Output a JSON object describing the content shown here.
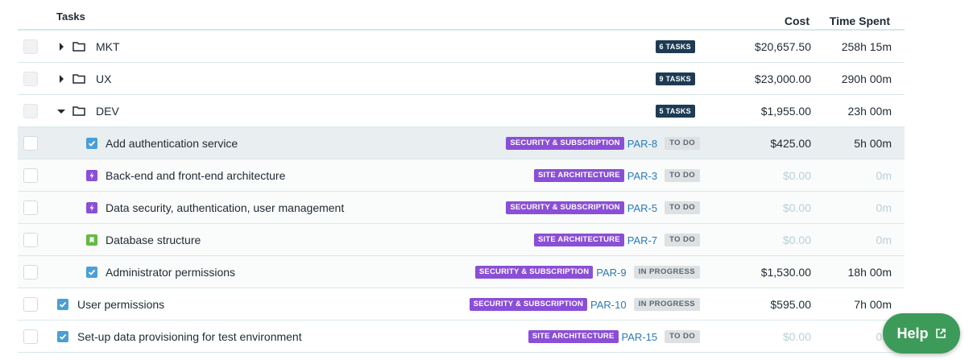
{
  "header": {
    "tasks": "Tasks",
    "cost": "Cost",
    "time": "Time Spent"
  },
  "groups": [
    {
      "name": "MKT",
      "count": "6 TASKS",
      "cost": "$20,657.50",
      "time": "258h 15m",
      "expanded": false
    },
    {
      "name": "UX",
      "count": "9 TASKS",
      "cost": "$23,000.00",
      "time": "290h 00m",
      "expanded": false
    },
    {
      "name": "DEV",
      "count": "5 TASKS",
      "cost": "$1,955.00",
      "time": "23h 00m",
      "expanded": true
    }
  ],
  "tasks": [
    {
      "name": "Add authentication service",
      "type": "task-icon",
      "epic": "SECURITY & SUBSCRIPTION",
      "key": "PAR-8",
      "status": "TO DO",
      "cost": "$425.00",
      "time": "5h 00m",
      "level": "child",
      "muted": false
    },
    {
      "name": "Back-end and front-end architecture",
      "type": "epic-icon",
      "epic": "SITE ARCHITECTURE",
      "key": "PAR-3",
      "status": "TO DO",
      "cost": "$0.00",
      "time": "0m",
      "level": "child",
      "muted": true
    },
    {
      "name": "Data security, authentication, user management",
      "type": "epic-icon",
      "epic": "SECURITY & SUBSCRIPTION",
      "key": "PAR-5",
      "status": "TO DO",
      "cost": "$0.00",
      "time": "0m",
      "level": "child",
      "muted": true
    },
    {
      "name": "Database structure",
      "type": "story-icon",
      "epic": "SITE ARCHITECTURE",
      "key": "PAR-7",
      "status": "TO DO",
      "cost": "$0.00",
      "time": "0m",
      "level": "child",
      "muted": true
    },
    {
      "name": "Administrator permissions",
      "type": "task-icon",
      "epic": "SECURITY & SUBSCRIPTION",
      "key": "PAR-9",
      "status": "IN PROGRESS",
      "cost": "$1,530.00",
      "time": "18h 00m",
      "level": "child",
      "muted": false
    },
    {
      "name": "User permissions",
      "type": "task-icon",
      "epic": "SECURITY & SUBSCRIPTION",
      "key": "PAR-10",
      "status": "IN PROGRESS",
      "cost": "$595.00",
      "time": "7h 00m",
      "level": "top",
      "muted": false
    },
    {
      "name": "Set-up data provisioning for test environment",
      "type": "task-icon",
      "epic": "SITE ARCHITECTURE",
      "key": "PAR-15",
      "status": "TO DO",
      "cost": "$0.00",
      "time": "0m",
      "level": "top",
      "muted": true
    }
  ],
  "help": {
    "label": "Help",
    "icon": "external-link-icon"
  },
  "colors": {
    "epic": "#8a4fd6",
    "count_badge": "#1e3b54",
    "task": "#4a9fd5",
    "epic_type": "#8a4fd6",
    "story": "#65ba43",
    "help": "#3d9b59",
    "key": "#2a7ab8"
  }
}
